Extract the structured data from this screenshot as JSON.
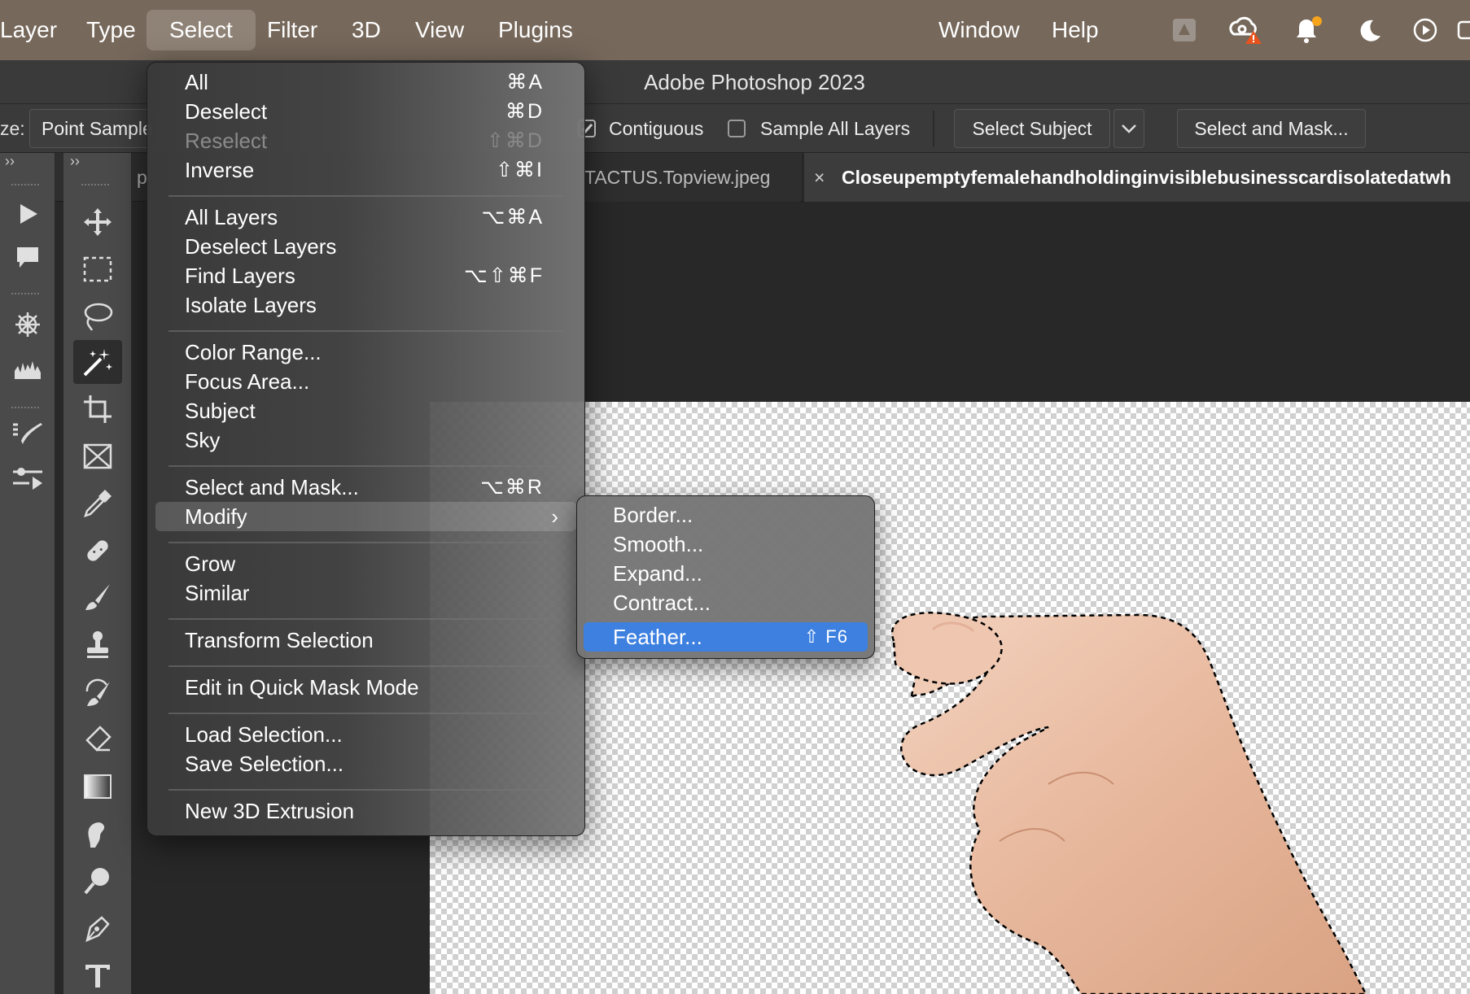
{
  "menubar": {
    "items": [
      "Layer",
      "Type",
      "Select",
      "Filter",
      "3D",
      "View",
      "Plugins",
      "Window",
      "Help"
    ]
  },
  "window": {
    "title": "Adobe Photoshop 2023"
  },
  "options": {
    "size_prefix": "ze:",
    "sample_size": "Point Sample",
    "contiguous_label": "Contiguous",
    "contiguous_checked": true,
    "sample_all_layers_label": "Sample All Layers",
    "sample_all_layers_checked": false,
    "select_subject_label": "Select Subject",
    "select_and_mask_label": "Select and Mask..."
  },
  "tabs": [
    {
      "label": "p",
      "active": false
    },
    {
      "label": "TACTUS.Topview.jpeg",
      "active": false
    },
    {
      "label": "Closeupemptyfemalehandholdinginvisiblebusinesscardisolatedatwh",
      "active": true
    }
  ],
  "select_menu": {
    "items": [
      {
        "label": "All",
        "shortcut": "⌘A"
      },
      {
        "label": "Deselect",
        "shortcut": "⌘D"
      },
      {
        "label": "Reselect",
        "shortcut": "⇧⌘D",
        "disabled": true
      },
      {
        "label": "Inverse",
        "shortcut": "⇧⌘I"
      },
      {
        "label": "All Layers",
        "shortcut": "⌥⌘A"
      },
      {
        "label": "Deselect Layers",
        "shortcut": ""
      },
      {
        "label": "Find Layers",
        "shortcut": "⌥⇧⌘F"
      },
      {
        "label": "Isolate Layers",
        "shortcut": ""
      },
      {
        "label": "Color Range...",
        "shortcut": ""
      },
      {
        "label": "Focus Area...",
        "shortcut": ""
      },
      {
        "label": "Subject",
        "shortcut": ""
      },
      {
        "label": "Sky",
        "shortcut": ""
      },
      {
        "label": "Select and Mask...",
        "shortcut": "⌥⌘R"
      },
      {
        "label": "Modify",
        "shortcut": "›",
        "highlighted": true
      },
      {
        "label": "Grow",
        "shortcut": ""
      },
      {
        "label": "Similar",
        "shortcut": ""
      },
      {
        "label": "Transform Selection",
        "shortcut": ""
      },
      {
        "label": "Edit in Quick Mask Mode",
        "shortcut": ""
      },
      {
        "label": "Load Selection...",
        "shortcut": ""
      },
      {
        "label": "Save Selection...",
        "shortcut": ""
      },
      {
        "label": "New 3D Extrusion",
        "shortcut": ""
      }
    ]
  },
  "modify_submenu": {
    "items": [
      {
        "label": "Border...",
        "shortcut": ""
      },
      {
        "label": "Smooth...",
        "shortcut": ""
      },
      {
        "label": "Expand...",
        "shortcut": ""
      },
      {
        "label": "Contract...",
        "shortcut": ""
      },
      {
        "label": "Feather...",
        "shortcut": "⇧ F6",
        "highlighted": true
      }
    ]
  },
  "colors": {
    "menubar": "#76685b",
    "highlight": "#3d80e0",
    "selection_outline": "#000000"
  }
}
